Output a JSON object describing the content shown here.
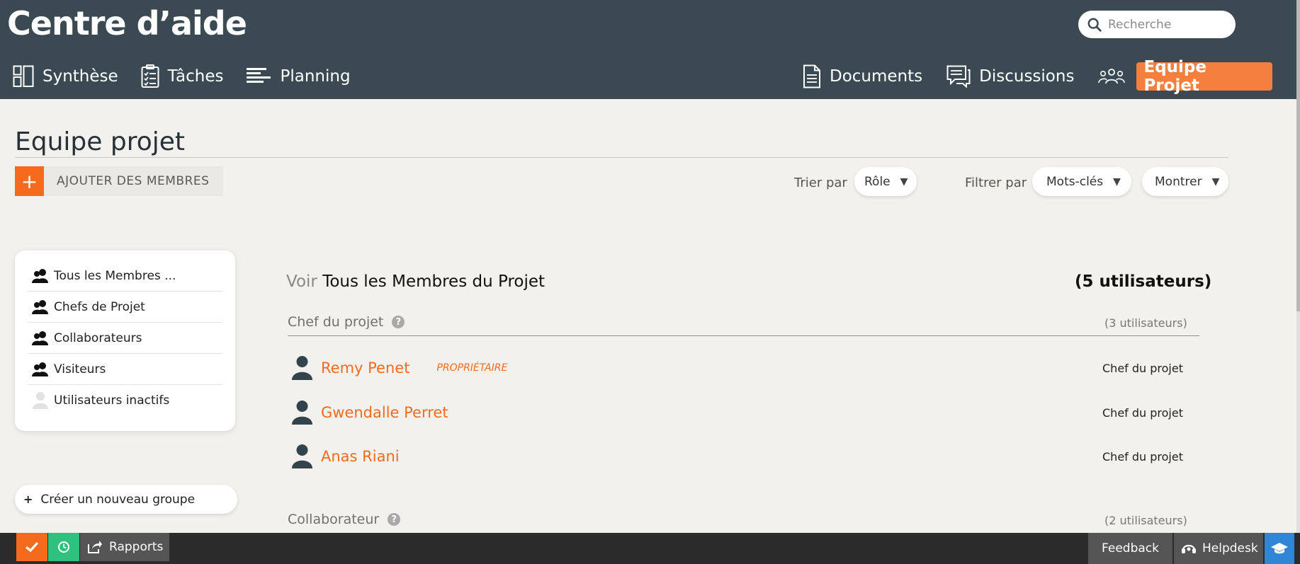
{
  "header": {
    "title": "Centre d’aide",
    "search_placeholder": "Recherche"
  },
  "nav": {
    "left": [
      {
        "label": "Synthèse",
        "icon": "dashboard-icon"
      },
      {
        "label": "Tâches",
        "icon": "clipboard-icon"
      },
      {
        "label": "Planning",
        "icon": "gantt-icon"
      }
    ],
    "right": [
      {
        "label": "Documents",
        "icon": "document-icon"
      },
      {
        "label": "Discussions",
        "icon": "chat-icon"
      },
      {
        "label": "Equipe Projet",
        "icon": "team-icon",
        "active": true
      }
    ]
  },
  "page": {
    "title": "Equipe projet",
    "add_members_label": "AJOUTER DES MEMBRES",
    "sort_label": "Trier par",
    "sort_value": "Rôle",
    "filter_label": "Filtrer par",
    "filter_keywords": "Mots-clés",
    "filter_show": "Montrer"
  },
  "sidebar": {
    "items": [
      {
        "label": "Tous les Membres ...",
        "icon": "users-icon"
      },
      {
        "label": "Chefs de Projet",
        "icon": "users-icon"
      },
      {
        "label": "Collaborateurs",
        "icon": "users-icon"
      },
      {
        "label": "Visiteurs",
        "icon": "users-icon"
      },
      {
        "label": "Utilisateurs inactifs",
        "icon": "inactive-user-icon"
      }
    ],
    "new_group_label": "Créer un nouveau groupe"
  },
  "main": {
    "voir_prefix": "Voir",
    "voir_title": "Tous les Membres du Projet",
    "total_count": "(5 utilisateurs)",
    "sections": [
      {
        "title": "Chef du projet",
        "count": "(3 utilisateurs)",
        "members": [
          {
            "name": "Remy Penet",
            "badge": "PROPRIÉTAIRE",
            "role": "Chef du projet"
          },
          {
            "name": "Gwendalle Perret",
            "badge": "",
            "role": "Chef du projet"
          },
          {
            "name": "Anas Riani",
            "badge": "",
            "role": "Chef du projet"
          }
        ]
      },
      {
        "title": "Collaborateur",
        "count": "(2 utilisateurs)",
        "members": []
      }
    ]
  },
  "bottombar": {
    "reports_label": "Rapports",
    "feedback_label": "Feedback",
    "helpdesk_label": "Helpdesk"
  },
  "colors": {
    "header_bg": "#3b4a52",
    "accent": "#f56a1b",
    "active_tab": "#f5803e",
    "timer_green": "#2ec27e",
    "academy_blue": "#2f86d6"
  }
}
